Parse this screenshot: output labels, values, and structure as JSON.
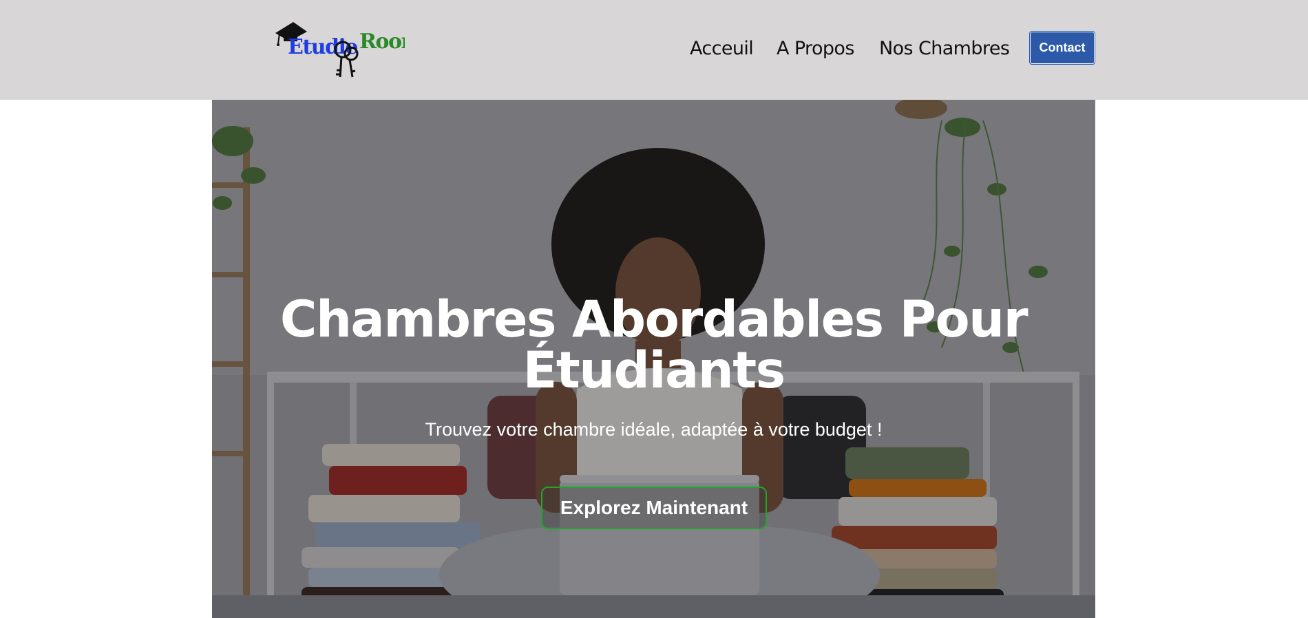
{
  "header": {
    "logo": {
      "word_left": "Etudie",
      "word_right": "Room",
      "color_left": "#1f3de0",
      "color_right": "#2a8a2a",
      "icons": [
        "graduation-cap-icon",
        "keys-icon"
      ]
    },
    "nav": {
      "items": [
        {
          "label": "Acceuil"
        },
        {
          "label": "A Propos"
        },
        {
          "label": "Nos Chambres"
        }
      ],
      "contact_label": "Contact",
      "contact_color": "#2c5aa8"
    }
  },
  "hero": {
    "title_line1": "Chambres Abordables Pour",
    "title_line2": "Étudiants",
    "subtitle": "Trouvez votre chambre idéale, adaptée à votre budget !",
    "cta_label": "Explorez Maintenant",
    "cta_border_color": "#22a52b"
  }
}
